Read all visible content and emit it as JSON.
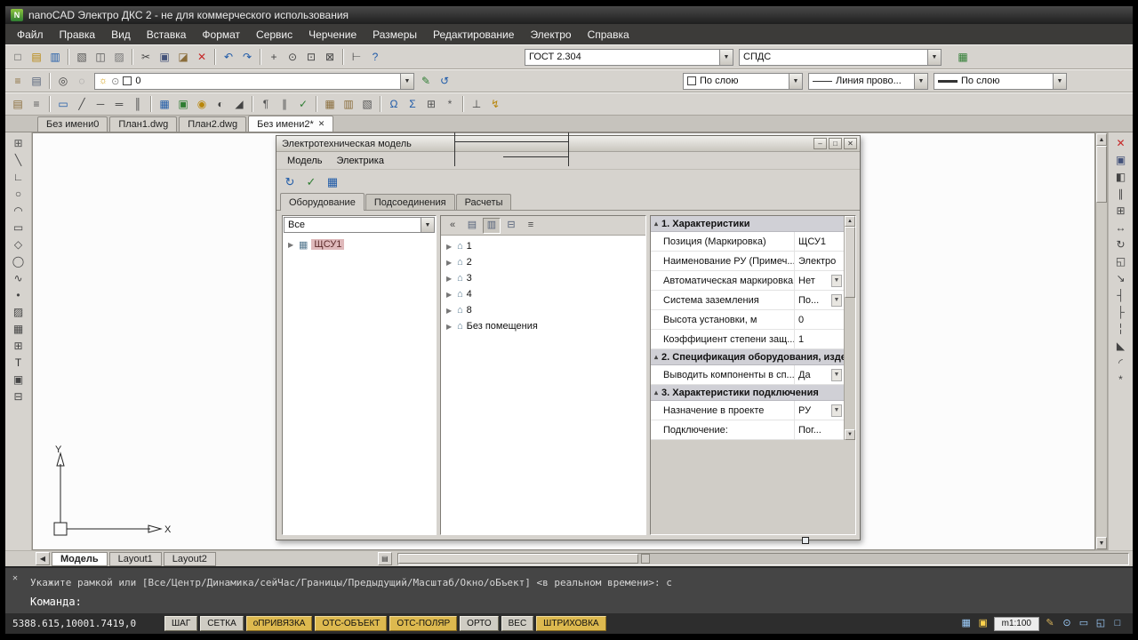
{
  "window": {
    "title": "nanoCAD Электро ДКС 2 - не для коммерческого использования"
  },
  "menu": {
    "items": [
      "Файл",
      "Правка",
      "Вид",
      "Вставка",
      "Формат",
      "Сервис",
      "Черчение",
      "Размеры",
      "Редактирование",
      "Электро",
      "Справка"
    ]
  },
  "toolbar1": {
    "text_style": "ГОСТ 2.304",
    "template": "СПДС"
  },
  "toolbar2": {
    "layer": "0",
    "color": "По слою",
    "linetype": "Линия прово...",
    "lineweight": "По слою"
  },
  "doc_tabs": [
    "Без имени0",
    "План1.dwg",
    "План2.dwg",
    "Без имени2*"
  ],
  "sheet_tabs": [
    "Модель",
    "Layout1",
    "Layout2"
  ],
  "command": {
    "history": "Укажите рамкой или [Все/Центр/Динамика/сейЧас/Границы/Предыдущий/Масштаб/Окно/оБъект] <в реальном времени>: с",
    "prompt": "Команда:"
  },
  "status": {
    "coords": "5388.615,10001.7419,0",
    "buttons": [
      "ШАГ",
      "СЕТКА",
      "оПРИВЯЗКА",
      "ОТС-ОБЪЕКТ",
      "ОТС-ПОЛЯР",
      "ОРТО",
      "ВЕС",
      "ШТРИХОВКА"
    ],
    "scale": "m1:100"
  },
  "ucs": {
    "x_label": "X",
    "y_label": "Y"
  },
  "dialog": {
    "title": "Электротехническая модель",
    "menu": [
      "Модель",
      "Электрика"
    ],
    "tabs": [
      "Оборудование",
      "Подсоединения",
      "Расчеты"
    ],
    "filter": "Все",
    "tree_left": [
      "ЩСУ1"
    ],
    "tree_mid": [
      "1",
      "2",
      "3",
      "4",
      "8",
      "Без помещения"
    ],
    "properties": {
      "sections": [
        {
          "title": "1. Характеристики",
          "rows": [
            {
              "label": "Позиция (Маркировка)",
              "value": "ЩСУ1"
            },
            {
              "label": "Наименование РУ (Примеч...",
              "value": "Электро"
            },
            {
              "label": "Автоматическая маркировка",
              "value": "Нет"
            },
            {
              "label": "Система заземления",
              "value": "По..."
            },
            {
              "label": "Высота установки, м",
              "value": "0"
            },
            {
              "label": "Коэффициент степени защ...",
              "value": "1"
            }
          ]
        },
        {
          "title": "2. Спецификация оборудования, изде...",
          "rows": [
            {
              "label": "Выводить компоненты в сп...",
              "value": "Да"
            }
          ]
        },
        {
          "title": "3. Характеристики подключения",
          "rows": [
            {
              "label": "Назначение в проекте",
              "value": "РУ"
            },
            {
              "label": "Подключение:",
              "value": "Пог..."
            }
          ]
        }
      ]
    },
    "toolbar": [
      {
        "n": "update-model-icon",
        "g": "↻",
        "c": "#1e5aa8"
      },
      {
        "n": "check-model-icon",
        "g": "✓",
        "c": "#2e7d32"
      },
      {
        "n": "model-reports-icon",
        "g": "▦",
        "c": "#1e5aa8"
      }
    ],
    "mid_toolbar": [
      {
        "n": "collapse-all-icon",
        "g": "«",
        "c": "#444"
      },
      {
        "n": "group-by-building-icon",
        "g": "▤",
        "c": "#55627a"
      },
      {
        "n": "group-by-floor-icon",
        "g": "▥",
        "c": "#55627a",
        "p": true
      },
      {
        "n": "tree-view-icon",
        "g": "⊟",
        "c": "#55627a"
      },
      {
        "n": "list-view-icon",
        "g": "≡",
        "c": "#444"
      }
    ]
  },
  "toolbars": {
    "standard": [
      {
        "n": "new-icon",
        "g": "□",
        "c": "#555"
      },
      {
        "n": "open-icon",
        "g": "▤",
        "c": "#b8860b"
      },
      {
        "n": "save-icon",
        "g": "▥",
        "c": "#1e5aa8"
      },
      {
        "sep": true
      },
      {
        "n": "plot-icon",
        "g": "▧",
        "c": "#555"
      },
      {
        "n": "print-preview-icon",
        "g": "◫",
        "c": "#555"
      },
      {
        "n": "publish-icon",
        "g": "▨",
        "c": "#777"
      },
      {
        "sep": true
      },
      {
        "n": "cut-icon",
        "g": "✂",
        "c": "#444"
      },
      {
        "n": "copy-icon",
        "g": "▣",
        "c": "#44527a"
      },
      {
        "n": "paste-icon",
        "g": "◪",
        "c": "#8a6d3b"
      },
      {
        "n": "erase-icon",
        "g": "✕",
        "c": "#c62828"
      },
      {
        "sep": true
      },
      {
        "n": "undo-icon",
        "g": "↶",
        "c": "#1e5aa8"
      },
      {
        "n": "redo-icon",
        "g": "↷",
        "c": "#1e5aa8"
      },
      {
        "sep": true
      },
      {
        "n": "pan-icon",
        "g": "+",
        "c": "#444"
      },
      {
        "n": "zoom-realtime-icon",
        "g": "⊙",
        "c": "#444"
      },
      {
        "n": "zoom-window-icon",
        "g": "⊡",
        "c": "#444"
      },
      {
        "n": "zoom-extents-icon",
        "g": "⊠",
        "c": "#444"
      },
      {
        "sep": true
      },
      {
        "n": "distance-icon",
        "g": "⊢",
        "c": "#444"
      },
      {
        "n": "help-icon",
        "g": "?",
        "c": "#1e5aa8"
      }
    ],
    "spds": [
      {
        "n": "spds-panel-icon",
        "g": "▦",
        "c": "#2e7d32"
      }
    ],
    "layers_left": [
      {
        "n": "layers-icon",
        "g": "≡",
        "c": "#8a6d3b"
      },
      {
        "n": "layer-states-icon",
        "g": "▤",
        "c": "#55627a"
      },
      {
        "sep": true
      },
      {
        "n": "layer-isolate-icon",
        "g": "◎",
        "c": "#444"
      },
      {
        "n": "layer-off-icon",
        "g": "◌",
        "c": "#888"
      }
    ],
    "layers_right": [
      {
        "n": "set-object-layer-current-icon",
        "g": "✎",
        "c": "#2e7d32"
      },
      {
        "n": "layer-previous-icon",
        "g": "↺",
        "c": "#1e5aa8"
      }
    ],
    "electro": [
      {
        "n": "project-manager-icon",
        "g": "▤",
        "c": "#8a6d3b"
      },
      {
        "n": "project-settings-icon",
        "g": "≡",
        "c": "#555"
      },
      {
        "sep": true
      },
      {
        "n": "room-icon",
        "g": "▭",
        "c": "#1e5aa8"
      },
      {
        "n": "trace-icon",
        "g": "╱",
        "c": "#444"
      },
      {
        "n": "wire-icon",
        "g": "─",
        "c": "#444"
      },
      {
        "n": "cable-channel-icon",
        "g": "═",
        "c": "#444"
      },
      {
        "n": "riser-icon",
        "g": "║",
        "c": "#444"
      },
      {
        "sep": true
      },
      {
        "n": "switchboard-icon",
        "g": "▦",
        "c": "#1e5aa8"
      },
      {
        "n": "equipment-icon",
        "g": "▣",
        "c": "#2e7d32"
      },
      {
        "n": "luminaire-icon",
        "g": "◉",
        "c": "#b8860b"
      },
      {
        "n": "socket-icon",
        "g": "◐",
        "c": "#444"
      },
      {
        "n": "switch-icon",
        "g": "◢",
        "c": "#444"
      },
      {
        "sep": true
      },
      {
        "n": "marking-icon",
        "g": "¶",
        "c": "#555"
      },
      {
        "n": "align-marks-icon",
        "g": "∥",
        "c": "#555"
      },
      {
        "n": "check-collisions-icon",
        "g": "✓",
        "c": "#2e7d32"
      },
      {
        "sep": true
      },
      {
        "n": "cable-journal-icon",
        "g": "▦",
        "c": "#8a6d3b"
      },
      {
        "n": "specification-icon",
        "g": "▥",
        "c": "#8a6d3b"
      },
      {
        "n": "report-icon",
        "g": "▧",
        "c": "#555"
      },
      {
        "sep": true
      },
      {
        "n": "electro-model-icon",
        "g": "Ω",
        "c": "#1e5aa8"
      },
      {
        "n": "calc-currents-icon",
        "g": "Σ",
        "c": "#1e5aa8"
      },
      {
        "n": "db-elements-icon",
        "g": "⊞",
        "c": "#555"
      },
      {
        "n": "settings-icon",
        "g": "*",
        "c": "#555"
      },
      {
        "sep": true
      },
      {
        "n": "grounding-icon",
        "g": "⊥",
        "c": "#444"
      },
      {
        "n": "lightning-icon",
        "g": "↯",
        "c": "#b8860b"
      }
    ],
    "draw": [
      {
        "n": "osnap-settings-icon",
        "g": "⊞",
        "c": "#555"
      },
      {
        "n": "line-icon",
        "g": "╲",
        "c": "#444"
      },
      {
        "n": "polyline-icon",
        "g": "∟",
        "c": "#444"
      },
      {
        "n": "circle-icon",
        "g": "○",
        "c": "#444"
      },
      {
        "n": "arc-icon",
        "g": "◠",
        "c": "#444"
      },
      {
        "n": "rectangle-icon",
        "g": "▭",
        "c": "#444"
      },
      {
        "n": "polygon-icon",
        "g": "◇",
        "c": "#444"
      },
      {
        "n": "ellipse-icon",
        "g": "◯",
        "c": "#444"
      },
      {
        "n": "spline-icon",
        "g": "∿",
        "c": "#444"
      },
      {
        "n": "point-icon",
        "g": "•",
        "c": "#444"
      },
      {
        "n": "hatch-icon",
        "g": "▨",
        "c": "#444"
      },
      {
        "n": "region-icon",
        "g": "▦",
        "c": "#444"
      },
      {
        "n": "table-icon",
        "g": "⊞",
        "c": "#444"
      },
      {
        "n": "text-icon",
        "g": "T",
        "c": "#333"
      },
      {
        "n": "block-icon",
        "g": "▣",
        "c": "#444"
      },
      {
        "n": "insert-block-icon",
        "g": "⊟",
        "c": "#444"
      }
    ],
    "modify": [
      {
        "n": "erase-icon",
        "g": "✕",
        "c": "#c62828"
      },
      {
        "n": "copy-icon",
        "g": "▣",
        "c": "#44527a"
      },
      {
        "n": "mirror-icon",
        "g": "◧",
        "c": "#444"
      },
      {
        "n": "offset-icon",
        "g": "∥",
        "c": "#444"
      },
      {
        "n": "array-icon",
        "g": "⊞",
        "c": "#444"
      },
      {
        "n": "move-icon",
        "g": "↔",
        "c": "#444"
      },
      {
        "n": "rotate-icon",
        "g": "↻",
        "c": "#444"
      },
      {
        "n": "scale-icon",
        "g": "◱",
        "c": "#444"
      },
      {
        "n": "stretch-icon",
        "g": "↘",
        "c": "#444"
      },
      {
        "n": "trim-icon",
        "g": "┤",
        "c": "#444"
      },
      {
        "n": "extend-icon",
        "g": "├",
        "c": "#444"
      },
      {
        "n": "break-icon",
        "g": "╎",
        "c": "#444"
      },
      {
        "n": "chamfer-icon",
        "g": "◣",
        "c": "#444"
      },
      {
        "n": "fillet-icon",
        "g": "◜",
        "c": "#444"
      },
      {
        "n": "explode-icon",
        "g": "*",
        "c": "#444"
      }
    ]
  },
  "status_icons": {
    "left": [
      {
        "n": "snap-settings-icon",
        "g": "▦",
        "c": "#9fd0ff"
      },
      {
        "n": "notification-icon",
        "g": "▣",
        "c": "#ffd34d"
      }
    ],
    "right": [
      {
        "n": "draw-order-icon",
        "g": "✎",
        "c": "#d8b35a"
      },
      {
        "n": "zoom-status-icon",
        "g": "⊙",
        "c": "#9fd0ff"
      },
      {
        "n": "viewports-icon",
        "g": "▭",
        "c": "#9fd0ff"
      },
      {
        "n": "fullscreen-icon",
        "g": "◱",
        "c": "#9fd0ff"
      },
      {
        "n": "clean-screen-icon",
        "g": "□",
        "c": "#9fd0ff"
      }
    ]
  },
  "ui_icons": {
    "dropdown": "▼",
    "collapse": "▴",
    "expander": "▶",
    "minimize": "–",
    "maximize": "□",
    "close": "✕",
    "up": "▲",
    "down": "▼",
    "left": "◀",
    "right": "▶",
    "tree_node": "▦",
    "room": "⌂",
    "sheet_list": "▤",
    "bulb": "☼",
    "freeze": "⊙",
    "app_logo": "N"
  },
  "colors": {
    "status_button_active": "#ddb94f",
    "status_button_inactive": "#cfccc3",
    "selection_highlight": "#dfb9bb",
    "accent_red": "#c62828"
  }
}
